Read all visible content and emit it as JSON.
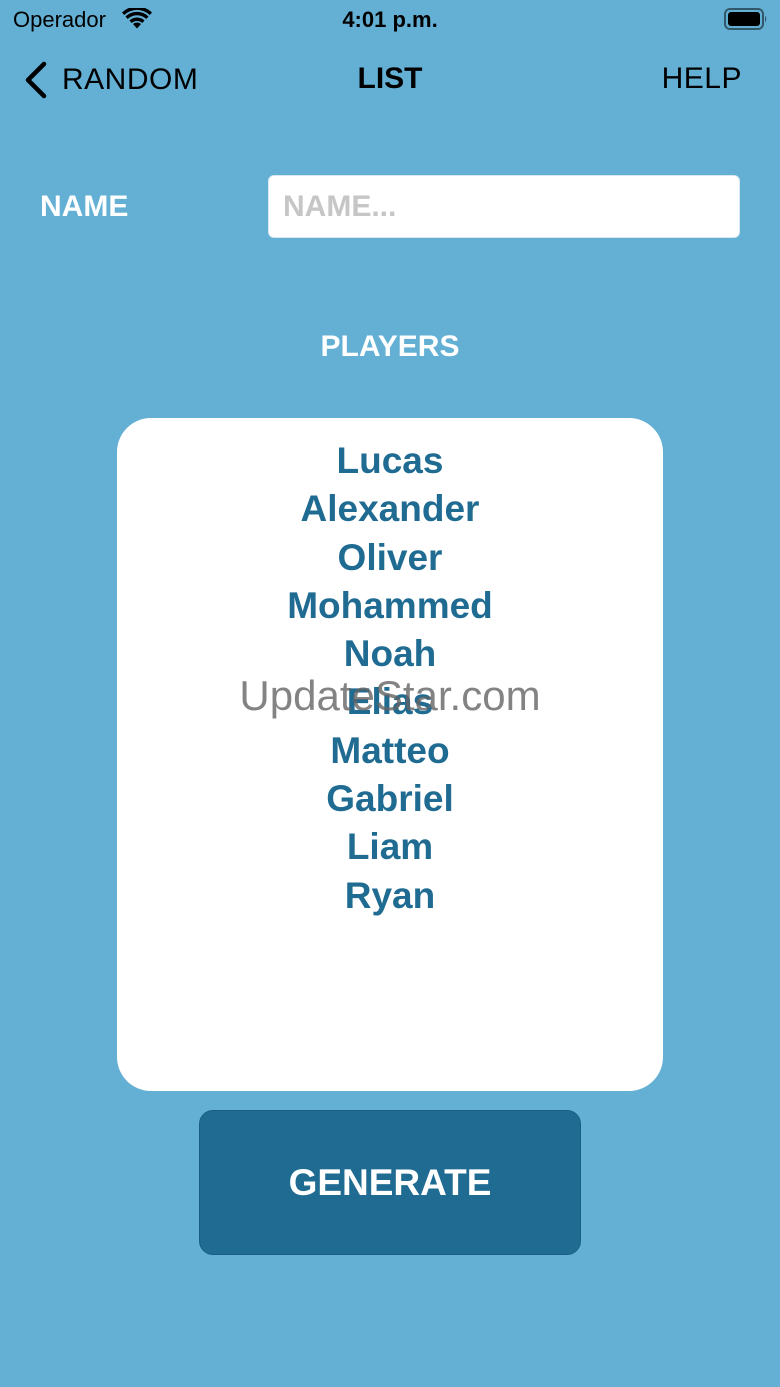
{
  "status_bar": {
    "carrier": "Operador",
    "time": "4:01 p.m.",
    "wifi_icon": "wifi-icon",
    "battery_icon": "battery-icon"
  },
  "nav": {
    "back_label": "RANDOM",
    "title": "LIST",
    "help_label": "HELP"
  },
  "form": {
    "name_label": "NAME",
    "name_value": "",
    "name_placeholder": "NAME..."
  },
  "players": {
    "title": "PLAYERS",
    "list": [
      "Lucas",
      "Alexander",
      "Oliver",
      "Mohammed",
      "Noah",
      "Elias",
      "Matteo",
      "Gabriel",
      "Liam",
      "Ryan"
    ]
  },
  "actions": {
    "generate_label": "GENERATE"
  },
  "watermark": "UpdateStar.com",
  "colors": {
    "background": "#63b0d4",
    "accent": "#1f6b92",
    "card": "#ffffff"
  }
}
